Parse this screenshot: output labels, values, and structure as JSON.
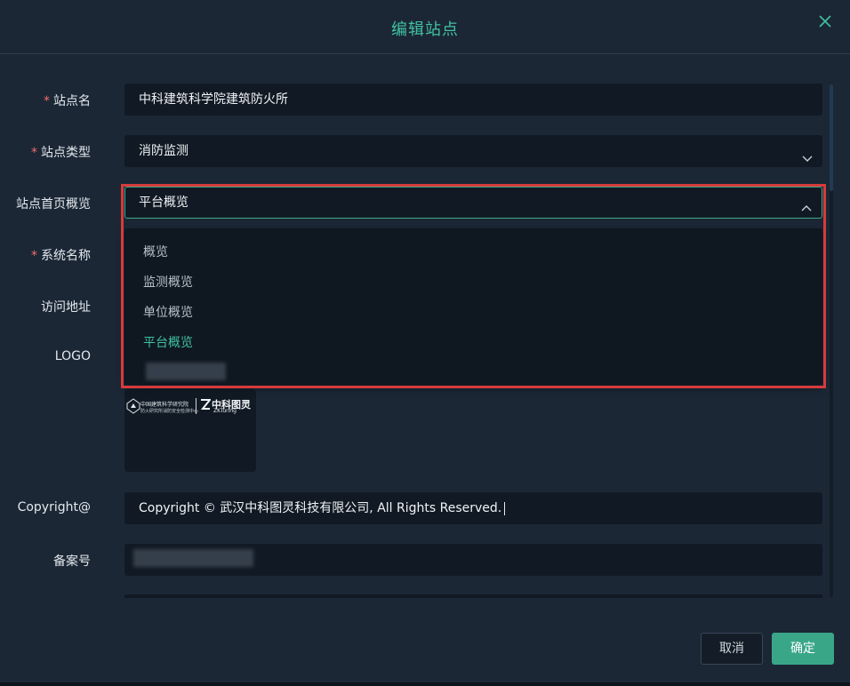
{
  "dialog": {
    "title": "编辑站点"
  },
  "form": {
    "site_name": {
      "required": true,
      "label": "站点名",
      "value": "中科建筑科学院建筑防火所"
    },
    "site_type": {
      "required": true,
      "label": "站点类型",
      "value": "消防监测"
    },
    "home_overview": {
      "required": false,
      "label": "站点首页概览",
      "value": "平台概览"
    },
    "system_name": {
      "required": true,
      "label": "系统名称"
    },
    "access_url": {
      "required": false,
      "label": "访问地址"
    },
    "logo": {
      "label": "LOGO",
      "left_text": "中国建筑科学研究院",
      "left_subtext": "防火研究所消防安全检测中心",
      "brand_text": "中科图灵",
      "brand_sub": "ZKTuring"
    },
    "copyright": {
      "label": "Copyright@",
      "value": "Copyright © 武汉中科图灵科技有限公司, All Rights Reserved."
    },
    "record_no": {
      "label": "备案号"
    }
  },
  "dropdown": {
    "options": [
      {
        "label": "概览",
        "selected": false
      },
      {
        "label": "监测概览",
        "selected": false
      },
      {
        "label": "单位概览",
        "selected": false
      },
      {
        "label": "平台概览",
        "selected": true
      }
    ]
  },
  "footer": {
    "cancel_label": "取消",
    "confirm_label": "确定"
  },
  "colors": {
    "accent": "#41c1a1",
    "primary_button": "#3aa688",
    "required": "#f56c6c",
    "highlight": "#d63b3b",
    "background": "#1b2735",
    "field": "#111a24"
  }
}
